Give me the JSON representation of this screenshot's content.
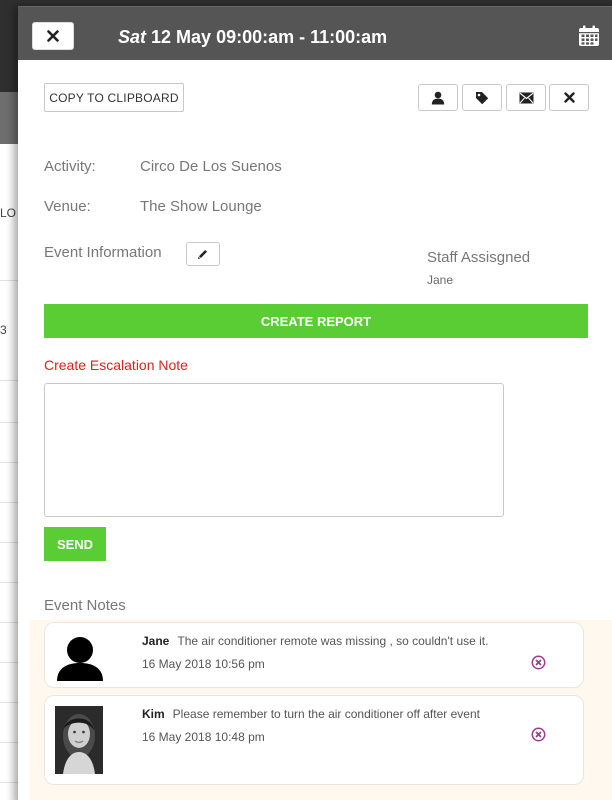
{
  "background": {
    "fragments": [
      "LO",
      "3"
    ]
  },
  "modal": {
    "header": {
      "day": "Sat",
      "datetime": "12 May 09:00:am - 11:00:am"
    },
    "toolbar": {
      "copy_label": "COPY TO CLIPBOARD",
      "icons": [
        "user-icon",
        "tag-icon",
        "envelope-icon",
        "close-icon"
      ]
    },
    "details": {
      "activity_label": "Activity:",
      "activity_value": "Circo De Los Suenos",
      "venue_label": "Venue:",
      "venue_value": "The Show Lounge",
      "event_info_label": "Event Information",
      "staff_label": "Staff Assisgned",
      "staff_name": "Jane"
    },
    "create_report_label": "CREATE REPORT",
    "escalation": {
      "label": "Create Escalation Note",
      "value": "",
      "send_label": "SEND"
    },
    "notes": {
      "title": "Event Notes",
      "items": [
        {
          "author": "Jane",
          "text": "The air conditioner remote was missing , so couldn't use it.",
          "time": "16 May 2018 10:56 pm",
          "avatar": "silhouette"
        },
        {
          "author": "Kim",
          "text": "Please remember to turn the air conditioner off after event",
          "time": "16 May 2018 10:48 pm",
          "avatar": "photo"
        }
      ]
    }
  },
  "colors": {
    "header_bg": "#555555",
    "green": "#5acd35",
    "escalation_red": "#e0201c",
    "delete_purple": "#9b3a8c",
    "notes_bg": "#fef8ee"
  }
}
